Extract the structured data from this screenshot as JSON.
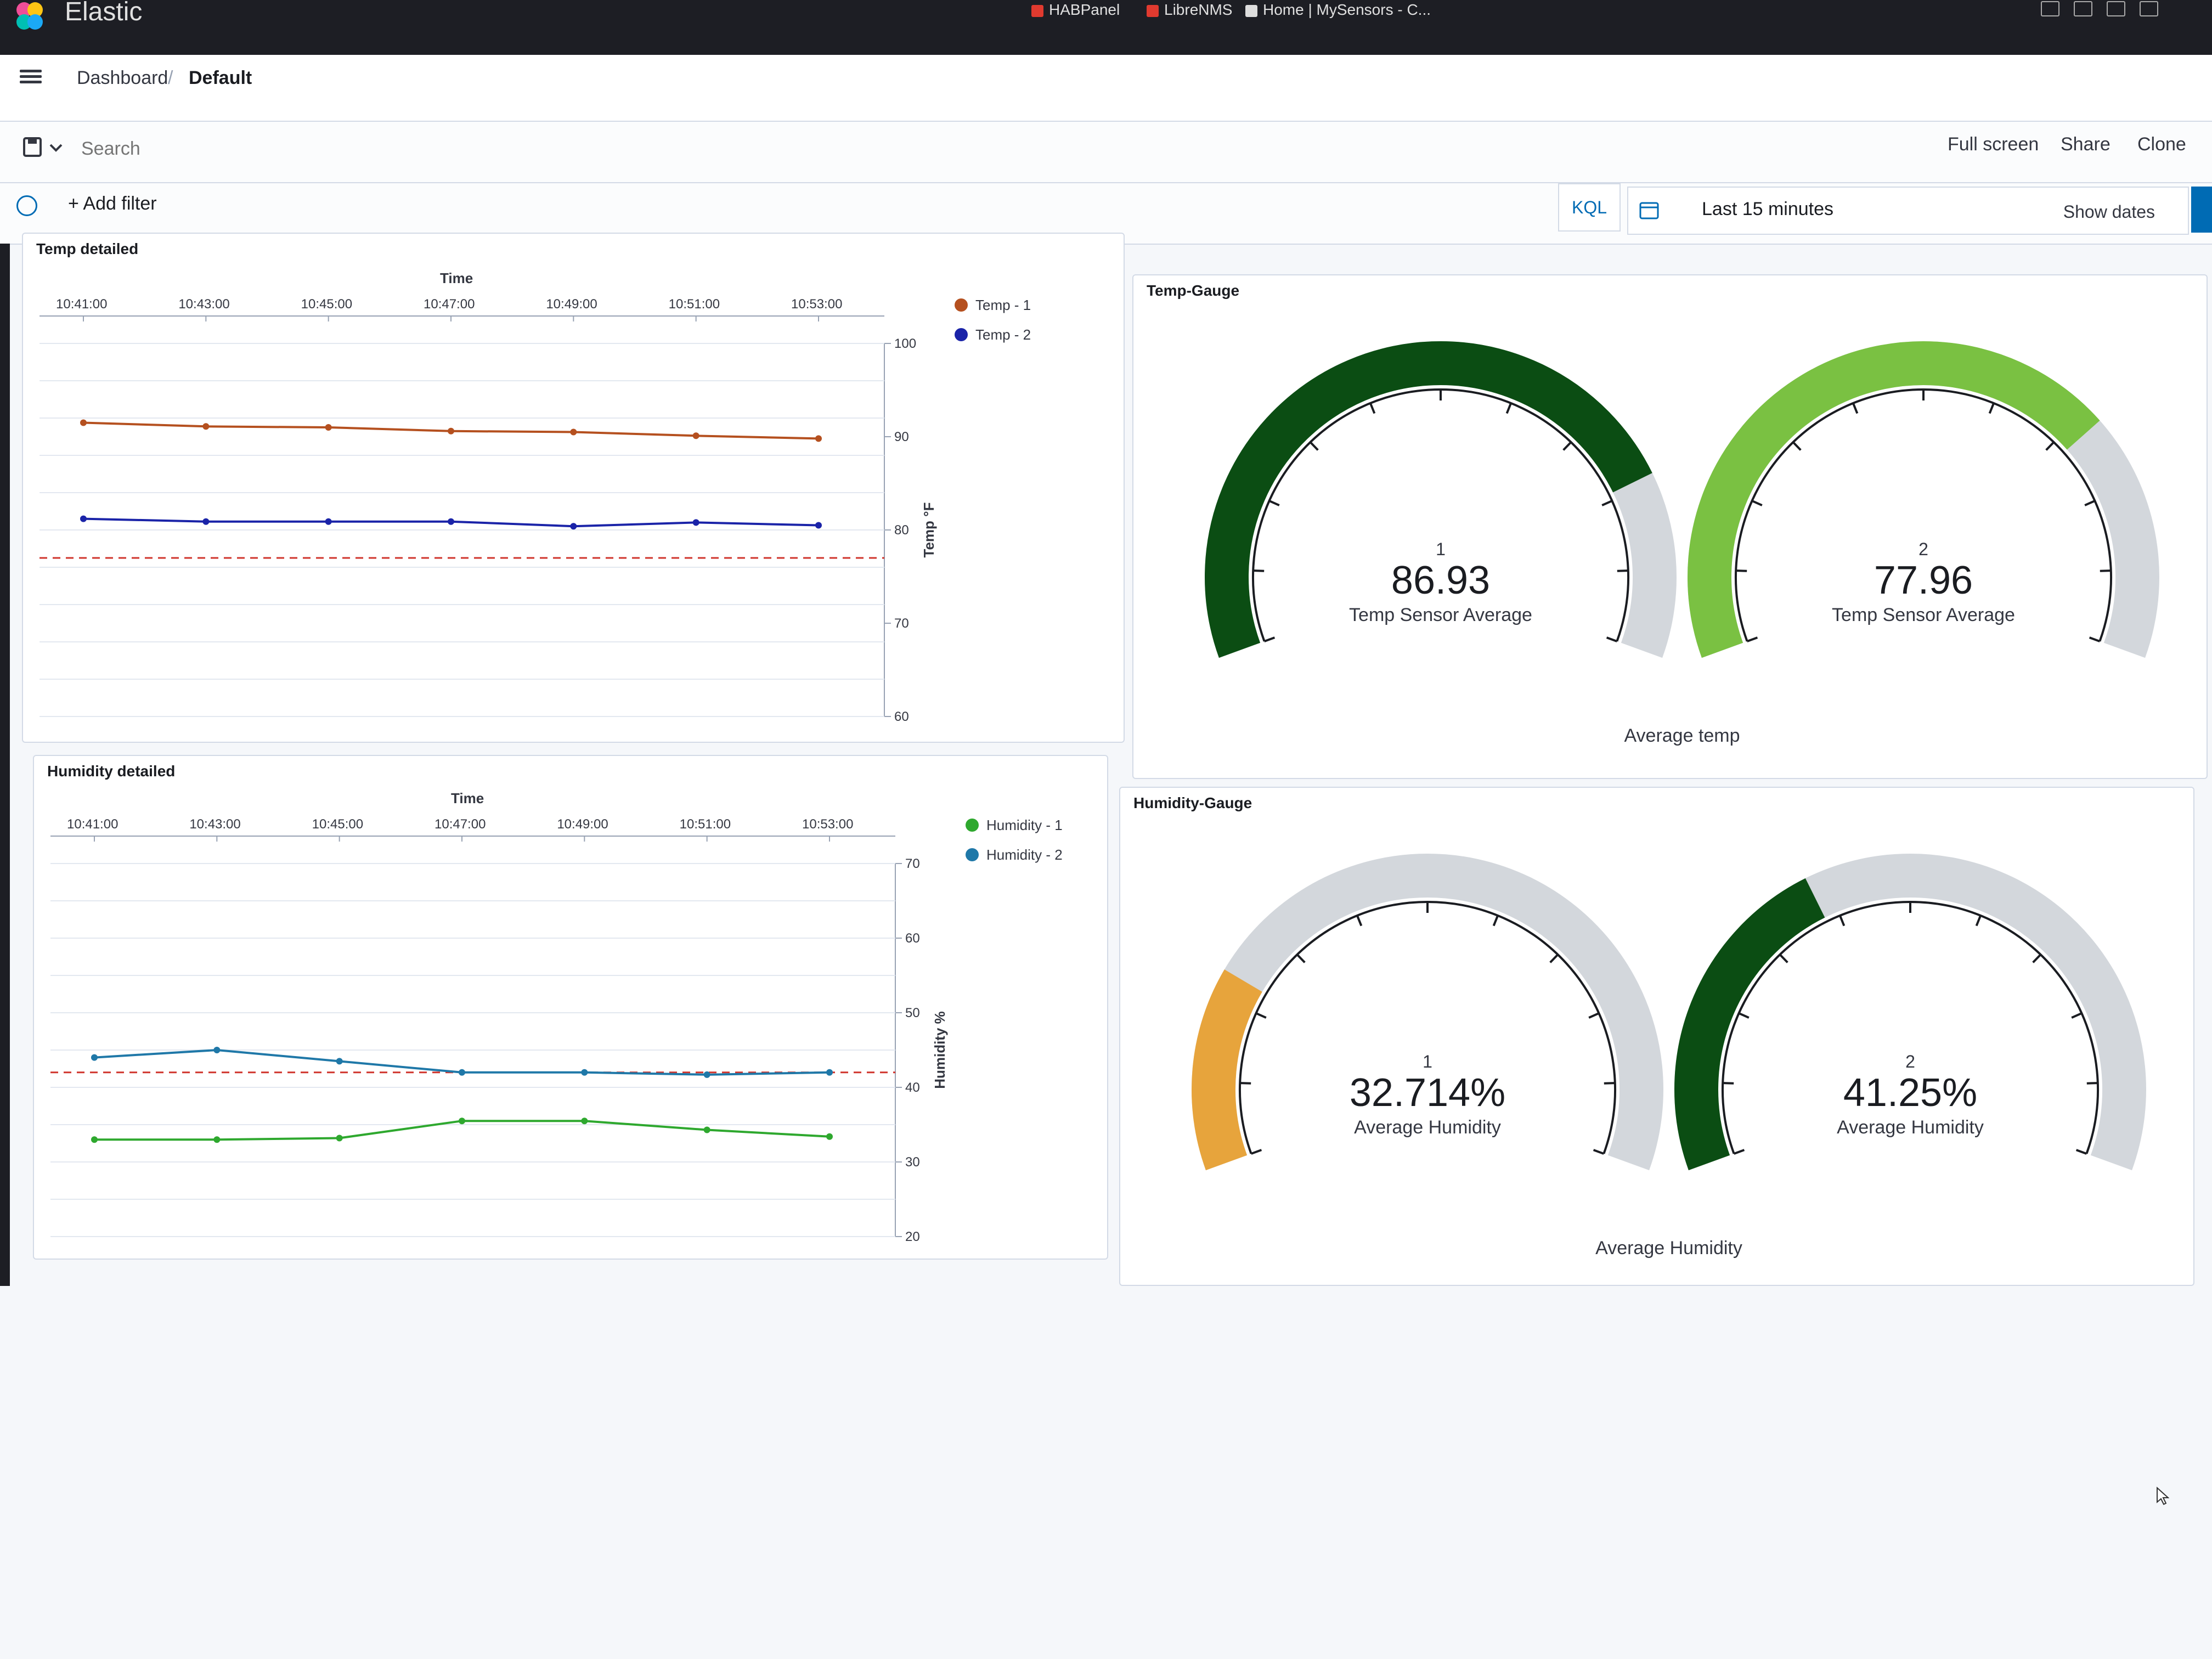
{
  "browser": {
    "bookmarks": [
      "HABPanel",
      "LibreNMS",
      "Home | MySensors - C..."
    ]
  },
  "app": {
    "brand": "Elastic"
  },
  "breadcrumbs": {
    "root": "Dashboard",
    "separator": "/",
    "current": "Default"
  },
  "query_bar": {
    "search_placeholder": "Search",
    "full_screen": "Full screen",
    "share": "Share",
    "clone": "Clone"
  },
  "filter_bar": {
    "add_filter": "+ Add filter",
    "language": "KQL",
    "time_range": "Last 15 minutes",
    "show_dates": "Show dates"
  },
  "panels": {
    "temp_detailed": {
      "title": "Temp detailed"
    },
    "temp_gauge": {
      "title": "Temp-Gauge",
      "footer": "Average temp",
      "gauges": [
        {
          "index": "1",
          "value": "86.93",
          "label": "Temp Sensor Average",
          "fill_fraction": 0.79,
          "color": "#0b4d13"
        },
        {
          "index": "2",
          "value": "77.96",
          "label": "Temp Sensor Average",
          "fill_fraction": 0.72,
          "color": "#7ac142"
        }
      ]
    },
    "humidity_detailed": {
      "title": "Humidity detailed"
    },
    "humidity_gauge": {
      "title": "Humidity-Gauge",
      "footer": "Average Humidity",
      "gauges": [
        {
          "index": "1",
          "value": "32.714%",
          "label": "Average Humidity",
          "fill_fraction": 0.23,
          "color": "#e7a43c"
        },
        {
          "index": "2",
          "value": "41.25%",
          "label": "Average Humidity",
          "fill_fraction": 0.38,
          "color": "#0b4d13"
        }
      ]
    }
  },
  "chart_data": [
    {
      "type": "line",
      "xlabel": "Time",
      "ylabel": "Temp °F",
      "x_ticks": [
        "10:41:00",
        "10:43:00",
        "10:45:00",
        "10:47:00",
        "10:49:00",
        "10:51:00",
        "10:53:00"
      ],
      "y_ticks": [
        "100",
        "90",
        "80",
        "70",
        "60"
      ],
      "ylim": [
        60,
        100
      ],
      "threshold": 77,
      "x": [
        "10:41:00",
        "10:43:00",
        "10:45:00",
        "10:47:00",
        "10:49:00",
        "10:51:00",
        "10:53:00"
      ],
      "series": [
        {
          "name": "Temp - 1",
          "color": "#b5501f",
          "values": [
            91.5,
            91.1,
            91.0,
            90.6,
            90.5,
            90.1,
            89.8
          ]
        },
        {
          "name": "Temp - 2",
          "color": "#1a23a8",
          "values": [
            81.2,
            80.9,
            80.9,
            80.9,
            80.4,
            80.8,
            80.5
          ]
        }
      ],
      "legend_position": "top-right"
    },
    {
      "type": "line",
      "xlabel": "Time",
      "ylabel": "Humidity %",
      "x_ticks": [
        "10:41:00",
        "10:43:00",
        "10:45:00",
        "10:47:00",
        "10:49:00",
        "10:51:00",
        "10:53:00"
      ],
      "y_ticks": [
        "70",
        "60",
        "50",
        "40",
        "30",
        "20"
      ],
      "ylim": [
        20,
        70
      ],
      "threshold": 42,
      "x": [
        "10:41:00",
        "10:43:00",
        "10:45:00",
        "10:47:00",
        "10:49:00",
        "10:51:00",
        "10:53:00"
      ],
      "series": [
        {
          "name": "Humidity - 1",
          "color": "#2ea82e",
          "values": [
            33.0,
            33.0,
            33.2,
            35.5,
            35.5,
            34.3,
            33.4
          ]
        },
        {
          "name": "Humidity - 2",
          "color": "#1f78a8",
          "values": [
            44.0,
            45.0,
            43.5,
            42.0,
            42.0,
            41.7,
            42.0
          ]
        }
      ],
      "legend_position": "top-right"
    }
  ]
}
